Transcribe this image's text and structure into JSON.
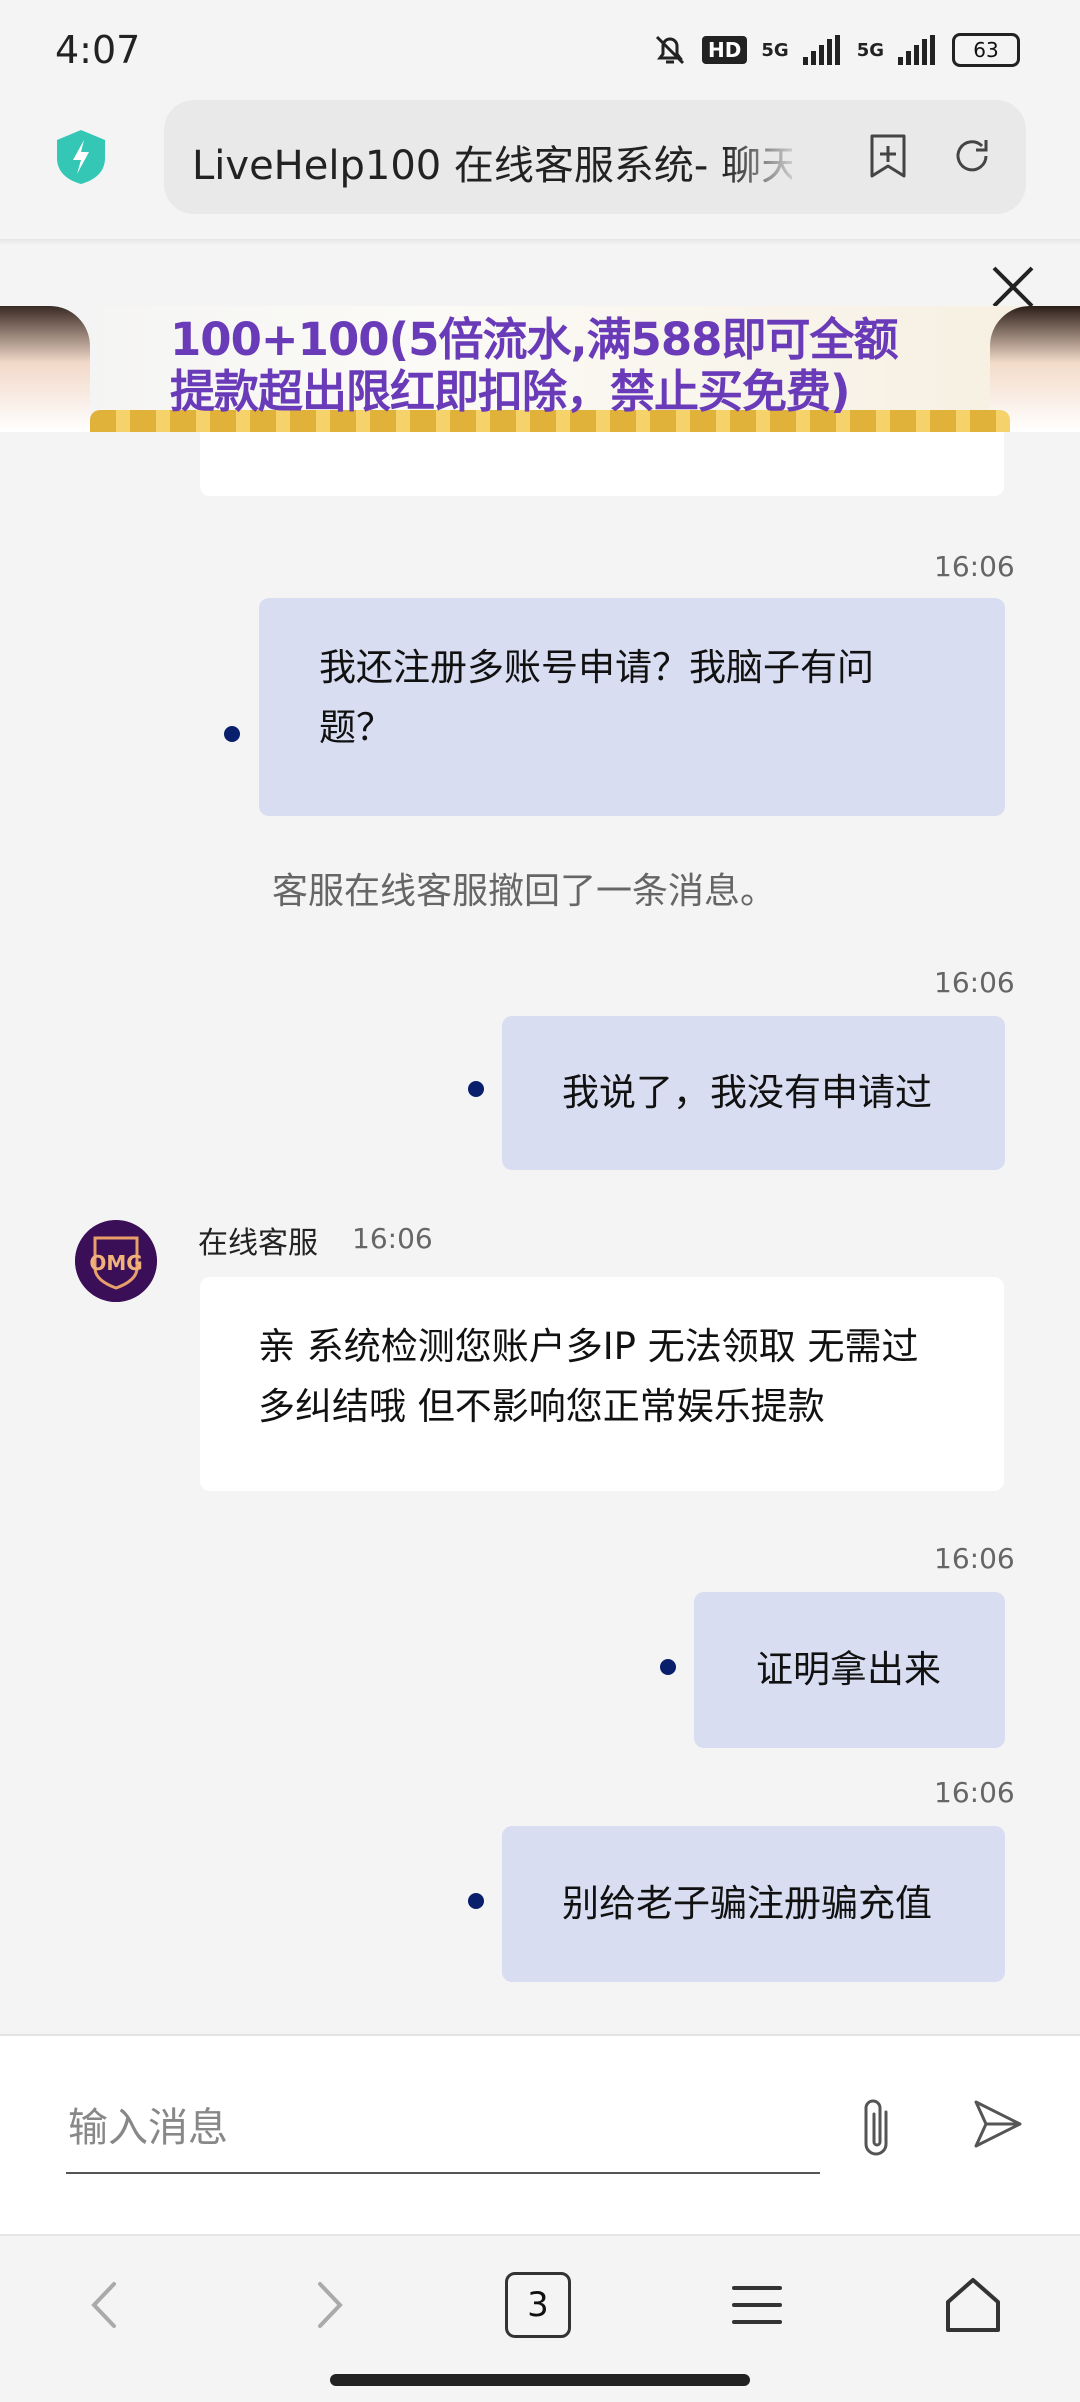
{
  "status": {
    "time": "4:07",
    "hd": "HD",
    "net1": "5G",
    "net2": "5G",
    "battery": "63"
  },
  "browser": {
    "url_title": "LiveHelp100 在线客服系统- 聊天",
    "tabs_count": "3"
  },
  "ad": {
    "line1": "100+100(5倍流水,满588即可全额",
    "line2": "提款超出限红即扣除，禁止买免费)"
  },
  "chat": {
    "m1": {
      "time": "16:06",
      "text_l1": "我还注册多账号申请？我脑子有问",
      "text_l2": "题？"
    },
    "system": "客服在线客服撤回了一条消息。",
    "m2": {
      "time": "16:06",
      "text": "我说了，我没有申请过"
    },
    "agent": {
      "name": "在线客服",
      "time": "16:06",
      "text_l1": "亲 系统检测您账户多IP 无法领取 无需过",
      "text_l2": "多纠结哦 但不影响您正常娱乐提款",
      "avatar_text": "OMG"
    },
    "m3": {
      "time": "16:06",
      "text": "证明拿出来"
    },
    "m4": {
      "time": "16:06",
      "text": "别给老子骗注册骗充值"
    }
  },
  "composer": {
    "placeholder": "输入消息"
  },
  "colors": {
    "user_bubble": "#d9ddf1",
    "agent_bubble": "#ffffff",
    "dot": "#0a1f6b",
    "ad_text": "#6a3bb8"
  }
}
